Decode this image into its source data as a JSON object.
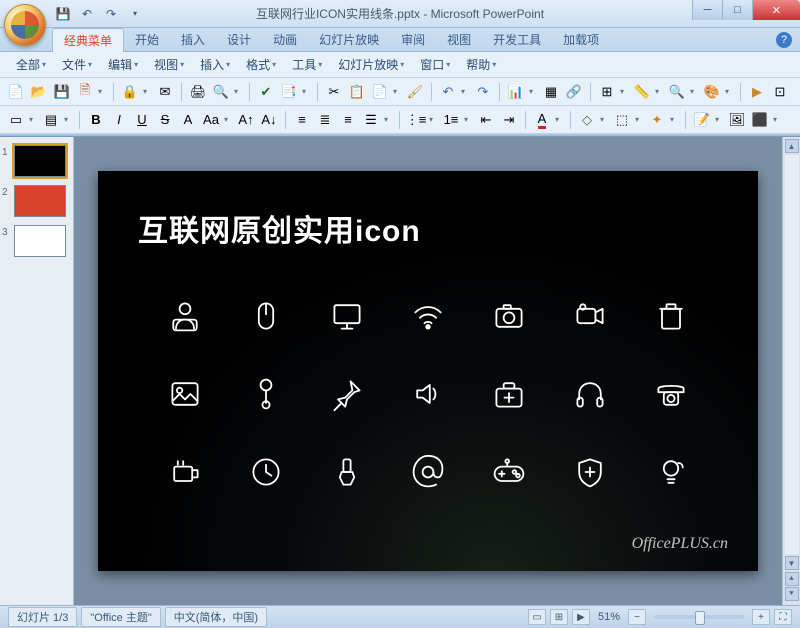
{
  "title": "互联网行业ICON实用线条.pptx - Microsoft PowerPoint",
  "ribbon_tabs": [
    "经典菜单",
    "开始",
    "插入",
    "设计",
    "动画",
    "幻灯片放映",
    "审阅",
    "视图",
    "开发工具",
    "加载项"
  ],
  "active_tab_index": 0,
  "classic_menus": [
    "全部",
    "文件",
    "编辑",
    "视图",
    "插入",
    "格式",
    "工具",
    "幻灯片放映",
    "窗口",
    "帮助"
  ],
  "slide": {
    "title": "互联网原创实用icon",
    "watermark": "OfficePLUS.cn"
  },
  "thumbnails": [
    {
      "num": "1",
      "style": "black",
      "active": true
    },
    {
      "num": "2",
      "style": "red",
      "active": false
    },
    {
      "num": "3",
      "style": "white",
      "active": false
    }
  ],
  "status": {
    "slide_indicator": "幻灯片 1/3",
    "theme": "\"Office 主题\"",
    "language": "中文(简体，中国)",
    "zoom": "51%"
  }
}
